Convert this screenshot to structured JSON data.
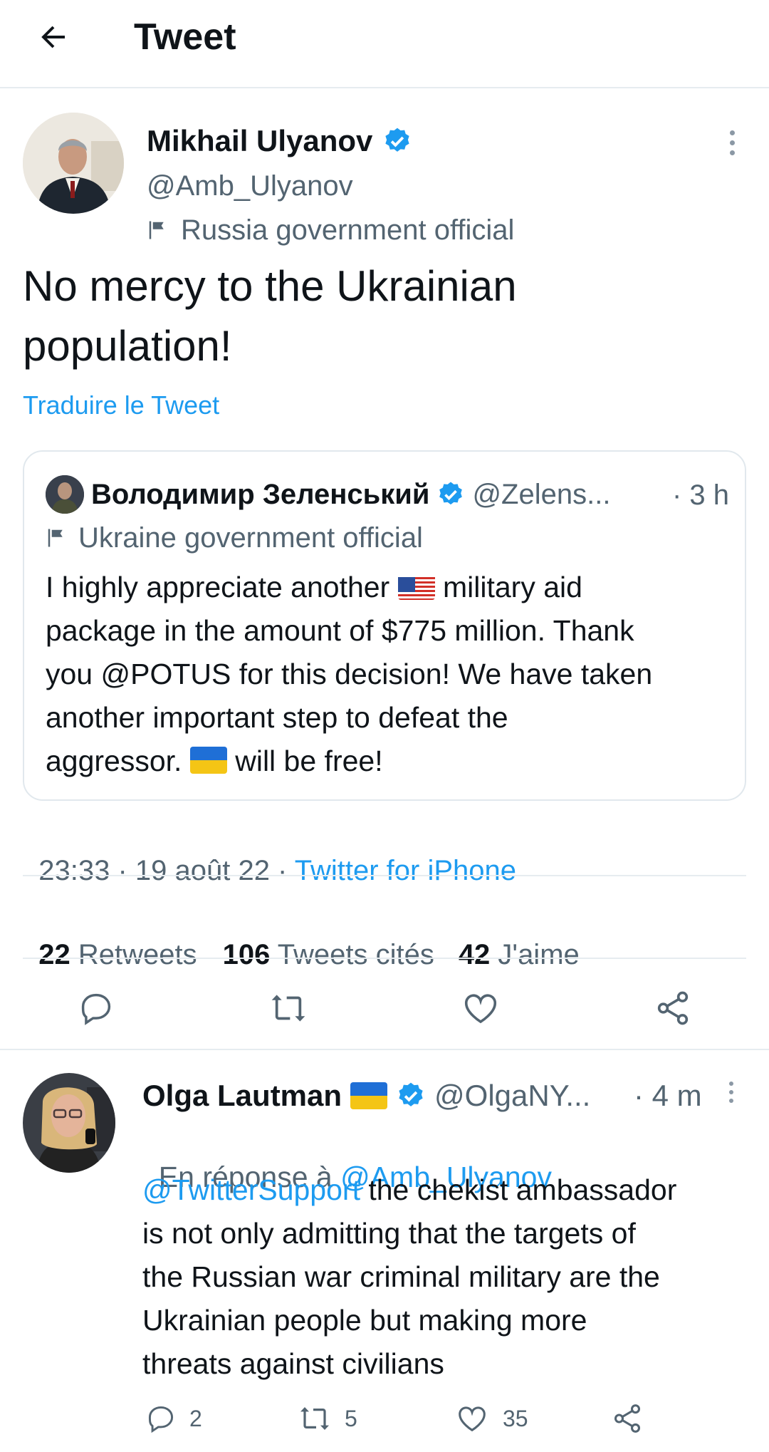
{
  "header": {
    "title": "Tweet"
  },
  "tweet": {
    "author_name": "Mikhail Ulyanov",
    "author_handle": "@Amb_Ulyanov",
    "label": "Russia government official",
    "text_line1": "No mercy to the Ukrainian",
    "text_line2": "population!",
    "translate": "Traduire le Tweet",
    "timestamp": "23:33 · 19 août 22 · ",
    "source": "Twitter for iPhone"
  },
  "quote": {
    "author_name": "Володимир Зеленський",
    "author_handle": "@Zelens...",
    "time": "· 3 h",
    "label": "Ukraine government official",
    "line1_a": "I highly appreciate another ",
    "line1_b": " military aid",
    "line2": "package in the amount of $775 million. Thank",
    "line3": "you @POTUS for this decision! We have taken",
    "line4": "another important step to defeat the",
    "line5_a": "aggressor. ",
    "line5_b": " will be free!"
  },
  "stats": {
    "retweets_count": "22",
    "retweets_label": " Retweets",
    "quotes_count": "106",
    "quotes_label": " Tweets cités",
    "likes_count": "42",
    "likes_label": " J'aime"
  },
  "reply": {
    "author_name": "Olga Lautman",
    "author_handle": "@OlgaNY...",
    "time": "· 4 m",
    "in_reply_prefix": "En réponse à ",
    "in_reply_handle": "@Amb_Ulyanov",
    "mention": "@TwitterSupport",
    "line1_rest": " the chekist ambassador",
    "line2": "is not only admitting that the targets of",
    "line3": "the Russian war criminal military are the",
    "line4": "Ukrainian people but making more",
    "line5": "threats against civilians",
    "reply_count": "2",
    "retweet_count": "5",
    "like_count": "35"
  },
  "icons": {
    "back": "back-arrow-icon",
    "verified": "verified-badge-icon",
    "flag": "flag-icon",
    "more": "more-vertical-icon",
    "reply": "reply-icon",
    "retweet": "retweet-icon",
    "like": "heart-icon",
    "share": "share-icon"
  },
  "colors": {
    "accent": "#1d9bf0",
    "text": "#0f1419",
    "secondary": "#536471",
    "border": "#e6ecf0"
  }
}
